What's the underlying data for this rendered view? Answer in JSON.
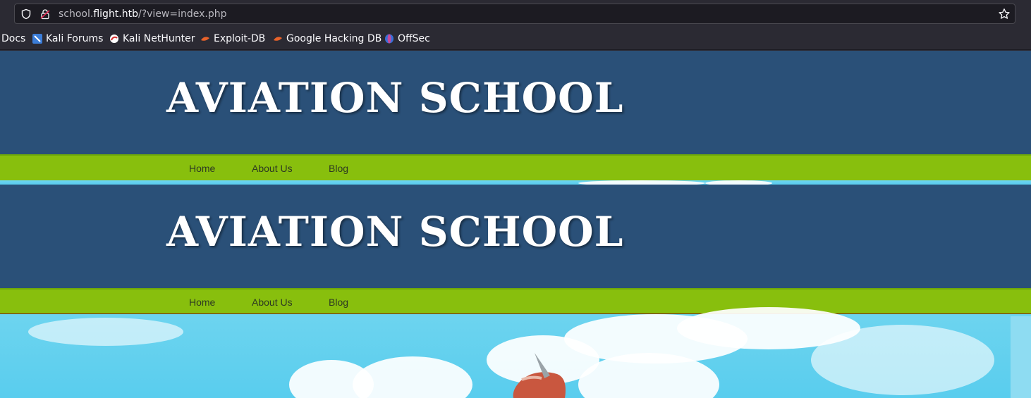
{
  "browser": {
    "url_prefix": "school.",
    "url_host": "flight.htb",
    "url_path": "/?view=index.php",
    "icons": [
      "shield-icon",
      "lock-icon",
      "star-icon"
    ]
  },
  "bookmarks": [
    {
      "label": "Docs"
    },
    {
      "label": "Kali Forums"
    },
    {
      "label": "Kali NetHunter"
    },
    {
      "label": "Exploit-DB"
    },
    {
      "label": "Google Hacking DB"
    },
    {
      "label": "OffSec"
    }
  ],
  "site": {
    "title": "AVIATION SCHOOL",
    "nav": [
      "Home",
      "About Us",
      "Blog"
    ],
    "title_repeat": "AVIATION SCHOOL",
    "nav_repeat": [
      "Home",
      "About Us",
      "Blog"
    ]
  },
  "colors": {
    "header": "#2a5078",
    "nav": "#88bf0d",
    "sky": "#5fd0ee"
  }
}
